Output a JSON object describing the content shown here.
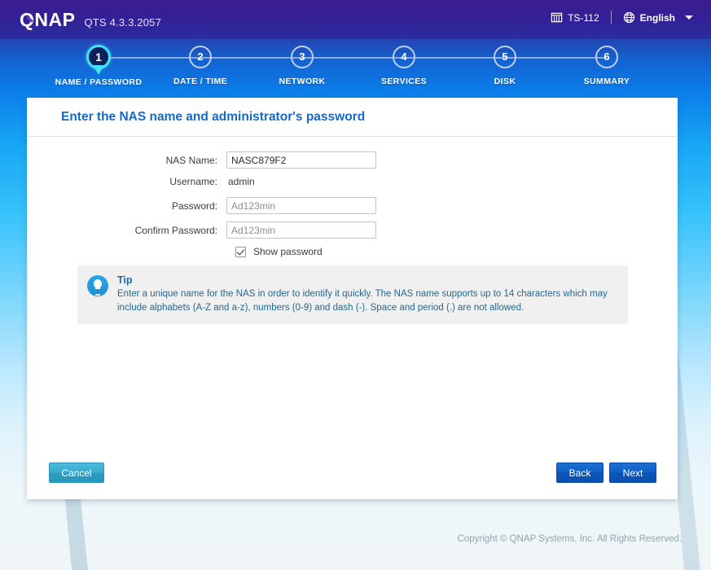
{
  "header": {
    "brand": "QNAP",
    "qts_version": "QTS 4.3.3.2057",
    "nas_model": "TS-112",
    "nas_icon": "nas-device-icon",
    "language": "English",
    "language_icon": "globe-icon",
    "caret_icon": "chevron-down-icon"
  },
  "stepper": {
    "steps": [
      {
        "number": "1",
        "label": "NAME / PASSWORD",
        "active": true
      },
      {
        "number": "2",
        "label": "DATE / TIME",
        "active": false
      },
      {
        "number": "3",
        "label": "NETWORK",
        "active": false
      },
      {
        "number": "4",
        "label": "SERVICES",
        "active": false
      },
      {
        "number": "5",
        "label": "DISK",
        "active": false
      },
      {
        "number": "6",
        "label": "SUMMARY",
        "active": false
      }
    ]
  },
  "panel": {
    "title": "Enter the NAS name and administrator's password",
    "fields": {
      "nas_name_label": "NAS Name:",
      "nas_name_value": "NASC879F2",
      "username_label": "Username:",
      "username_value": "admin",
      "password_label": "Password:",
      "password_value": "Ad123min",
      "confirm_password_label": "Confirm Password:",
      "confirm_password_value": "Ad123min",
      "show_password_label": "Show password",
      "show_password_checked": true
    },
    "tip": {
      "icon": "lightbulb-icon",
      "heading": "Tip",
      "body": "Enter a unique name for the NAS in order to identify it quickly. The NAS name supports up to 14 characters which may include alphabets (A-Z and a-z), numbers (0-9) and dash (-). Space and period (.) are not allowed."
    },
    "buttons": {
      "cancel": "Cancel",
      "back": "Back",
      "next": "Next"
    }
  },
  "footer": {
    "copyright": "Copyright © QNAP Systems, Inc. All Rights Reserved."
  },
  "colors": {
    "brand_purple": "#341f96",
    "accent_blue": "#1569c7",
    "active_step_ring": "#45e1f5",
    "tip_text": "#26688f",
    "cancel_button": "#3aa9cd",
    "nav_button": "#0f5fc6"
  }
}
